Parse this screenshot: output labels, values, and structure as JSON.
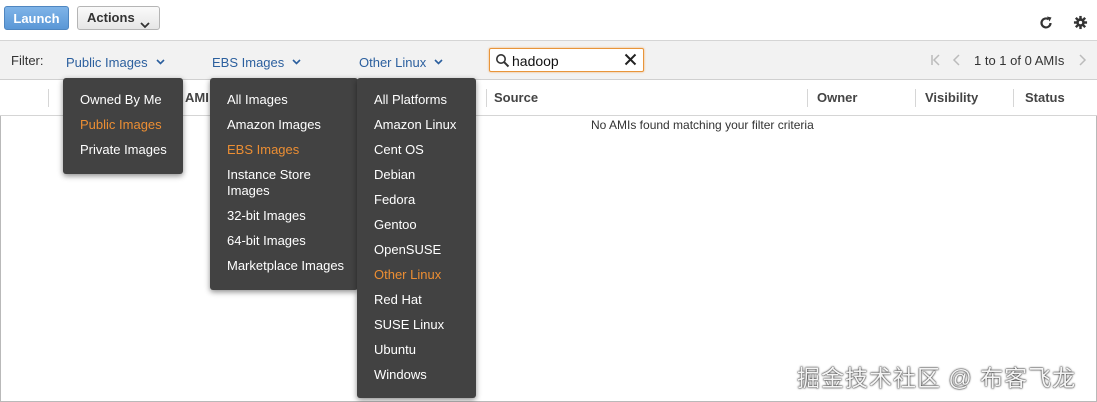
{
  "toolbar": {
    "launch_label": "Launch",
    "actions_label": "Actions"
  },
  "filter": {
    "label": "Filter:",
    "dropdown_visibility": "Public Images",
    "dropdown_type": "EBS Images",
    "dropdown_platform": "Other Linux",
    "search_value": "hadoop",
    "pager_text": "1 to 1 of 0 AMIs"
  },
  "table": {
    "columns": [
      "AMI",
      "Source",
      "Owner",
      "Visibility",
      "Status"
    ],
    "empty_message": "No AMIs found matching your filter criteria"
  },
  "menus": {
    "visibility": {
      "items": [
        "Owned By Me",
        "Public Images",
        "Private Images"
      ],
      "selected": "Public Images"
    },
    "type": {
      "items": [
        "All Images",
        "Amazon Images",
        "EBS Images",
        "Instance Store",
        "Images",
        "32-bit Images",
        "64-bit Images",
        "Marketplace Images"
      ],
      "selected": "EBS Images"
    },
    "platform": {
      "items": [
        "All Platforms",
        "Amazon Linux",
        "Cent OS",
        "Debian",
        "Fedora",
        "Gentoo",
        "OpenSUSE",
        "Other Linux",
        "Red Hat",
        "SUSE Linux",
        "Ubuntu",
        "Windows"
      ],
      "selected": "Other Linux"
    }
  },
  "watermark": "掘金技术社区 @ 布客飞龙",
  "colors": {
    "menu_bg": "#424242",
    "menu_selected": "#ec8e33",
    "link_blue": "#2b5f9e",
    "search_focus": "#e8953a"
  }
}
